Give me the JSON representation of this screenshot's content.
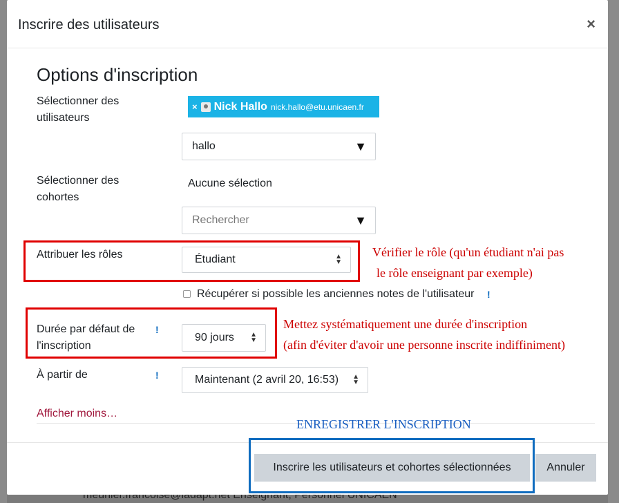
{
  "modal": {
    "title": "Inscrire des utilisateurs",
    "close_glyph": "×"
  },
  "section_title": "Options d'inscription",
  "select_users": {
    "label_line1": "Sélectionner des",
    "label_line2": "utilisateurs",
    "chip_remove": "×",
    "chip_name": "Nick Hallo",
    "chip_email": "nick.hallo@etu.unicaen.fr",
    "search_value": "hallo"
  },
  "select_cohorts": {
    "label_line1": "Sélectionner des",
    "label_line2": "cohortes",
    "none_selected": "Aucune sélection",
    "search_placeholder": "Rechercher"
  },
  "roles": {
    "label": "Attribuer les rôles",
    "selected": "Étudiant"
  },
  "recover_grades": {
    "label": "Récupérer si possible les anciennes notes de l'utilisateur",
    "checked": false
  },
  "duration": {
    "label_line1": "Durée par défaut de",
    "label_line2": "l'inscription",
    "selected": "90 jours"
  },
  "start": {
    "label": "À partir de",
    "selected": "Maintenant (2 avril 20, 16:53)"
  },
  "help_glyph": "!",
  "show_less_link": "Afficher moins…",
  "buttons": {
    "enrol": "Inscrire les utilisateurs et cohortes sélectionnées",
    "cancel": "Annuler"
  },
  "annotations": {
    "role_note_line1": "Vérifier le rôle (qu'un étudiant n'ai pas",
    "role_note_line2": "le rôle enseignant par exemple)",
    "duration_note_line1": "Mettez systématiquement une durée d'inscription",
    "duration_note_line2": "(afin d'éviter d'avoir une personne inscrite indiffiniment)",
    "save_note": "ENREGISTRER L'INSCRIPTION",
    "red": "#e00000",
    "blue": "#0f6cbf"
  },
  "background": {
    "bottom_text": "meunier.francoise@ladapt.net   Enseignant, Personnel UNICAEN"
  },
  "colors": {
    "chip_bg": "#1bb3e6",
    "link": "#a0173c",
    "help": "#0f6cbf",
    "button_bg": "#ced4da"
  }
}
